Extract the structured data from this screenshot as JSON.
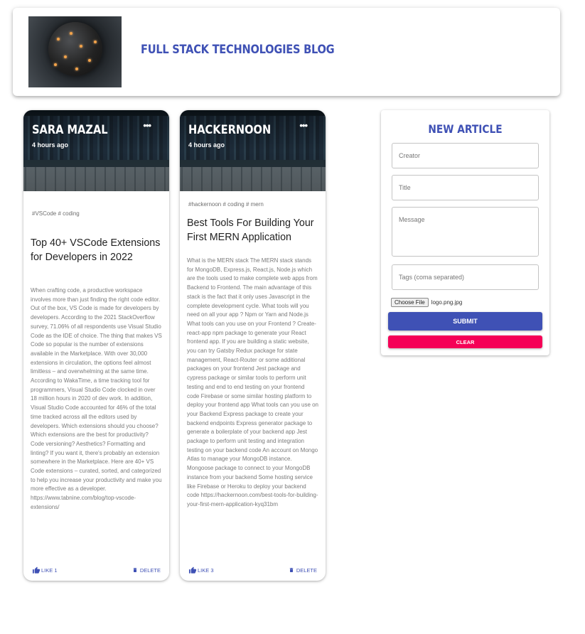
{
  "header": {
    "brand_title": "FULL STACK TECHNOLOGIES BLOG",
    "logo_icon": "sphere-circuit-logo",
    "accent_color": "#3f51b5"
  },
  "posts": [
    {
      "creator": "SARA MAZAL",
      "time": "4 hours ago",
      "tags": "#VSCode # coding",
      "title": "Top 40+ VSCode Extensions for Developers in 2022",
      "message": "When crafting code, a productive workspace involves more than just finding the right code editor. Out of the box, VS Code is made for developers by developers. According to the 2021 StackOverflow survey, 71.06% of all respondents use Visual Studio Code as the IDE of choice. The thing that makes VS Code so popular is the number of extensions available in the Marketplace. With over 30,000 extensions in circulation, the options feel almost limitless – and overwhelming at the same time. According to WakaTime, a time tracking tool for programmers, Visual Studio Code clocked in over 18 million hours in 2020 of dev work. In addition, Visual Studio Code accounted for 46% of the total time tracked across all the editors used by developers. Which extensions should you choose? Which extensions are the best for productivity? Code versioning? Aesthetics? Formatting and linting? If you want it, there's probably an extension somewhere in the Marketplace. Here are 40+ VS Code extensions – curated, sorted, and categorized to help you increase your productivity and make you more effective as a developer. https://www.tabnine.com/blog/top-vscode-extensions/",
      "like_label": "LIKE 1",
      "delete_label": "DELETE"
    },
    {
      "creator": "HACKERNOON",
      "time": "4 hours ago",
      "tags": "#hackernoon # coding # mern",
      "title": "Best Tools For Building Your First MERN Application",
      "message": "What is the MERN stack The MERN stack stands for MongoDB, Express.js, React.js, Node.js which are the tools used to make complete web apps from Backend to Frontend. The main advantage of this stack is the fact that it only uses Javascript in the complete development cycle. What tools will you need on all your app ? Npm or Yarn and Node.js What tools can you use on your Frontend ? Create-react-app npm package to generate your React frontend app. If you are building a static website, you can try Gatsby Redux package for state management, React-Router or some additional packages on your frontend Jest package and cypress package or similar tools to perform unit testing and end to end testing on your frontend code Firebase or some similar hosting platform to deploy your frontend app What tools can you use on your Backend Express package to create your backend endpoints Express generator package to generate a boilerplate of your backend app Jest package to perform unit testing and integration testing on your backend code An account on Mongo Atlas to manage your MongoDB instance. Mongoose package to connect to your MongoDB instance from your backend Some hosting service like Firebase or Heroku to deploy your backend code https://hackernoon.com/best-tools-for-building-your-first-mern-application-kyq31bm",
      "like_label": "LIKE 3",
      "delete_label": "DELETE"
    }
  ],
  "form": {
    "heading": "NEW ARTICLE",
    "creator_placeholder": "Creator",
    "title_placeholder": "Title",
    "message_placeholder": "Message",
    "tags_placeholder": "Tags (coma separated)",
    "file_button": "Choose File",
    "file_name": "logo.png.jpg",
    "submit_label": "SUBMIT",
    "clear_label": "CLEAR",
    "submit_color": "#3f51b5",
    "clear_color": "#f50057"
  }
}
